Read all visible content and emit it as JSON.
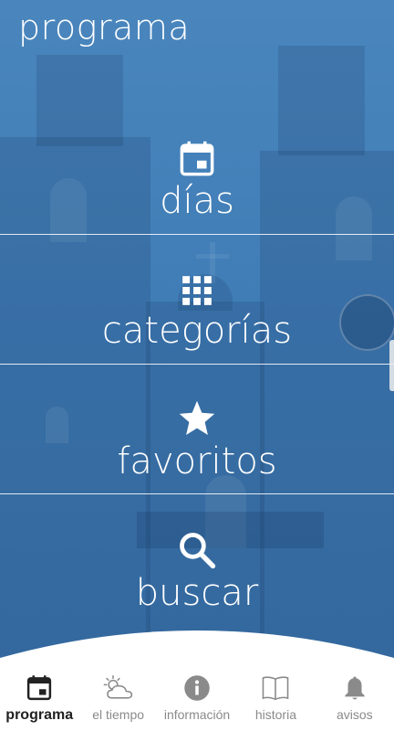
{
  "app": {
    "title": "programa"
  },
  "menu": [
    {
      "label": "días",
      "icon": "calendar-icon"
    },
    {
      "label": "categorías",
      "icon": "grid-icon"
    },
    {
      "label": "favoritos",
      "icon": "star-icon"
    },
    {
      "label": "buscar",
      "icon": "search-icon"
    }
  ],
  "nav": {
    "tabs": [
      {
        "label": "programa",
        "icon": "calendar-icon",
        "active": true
      },
      {
        "label": "el tiempo",
        "icon": "weather-icon",
        "active": false
      },
      {
        "label": "información",
        "icon": "info-icon",
        "active": false
      },
      {
        "label": "historia",
        "icon": "book-icon",
        "active": false
      },
      {
        "label": "avisos",
        "icon": "bell-icon",
        "active": false
      }
    ]
  },
  "colors": {
    "overlay": "#3f7cb6",
    "text": "#ffffff",
    "nav_active": "#222222",
    "nav_inactive": "#8a8a8a"
  }
}
